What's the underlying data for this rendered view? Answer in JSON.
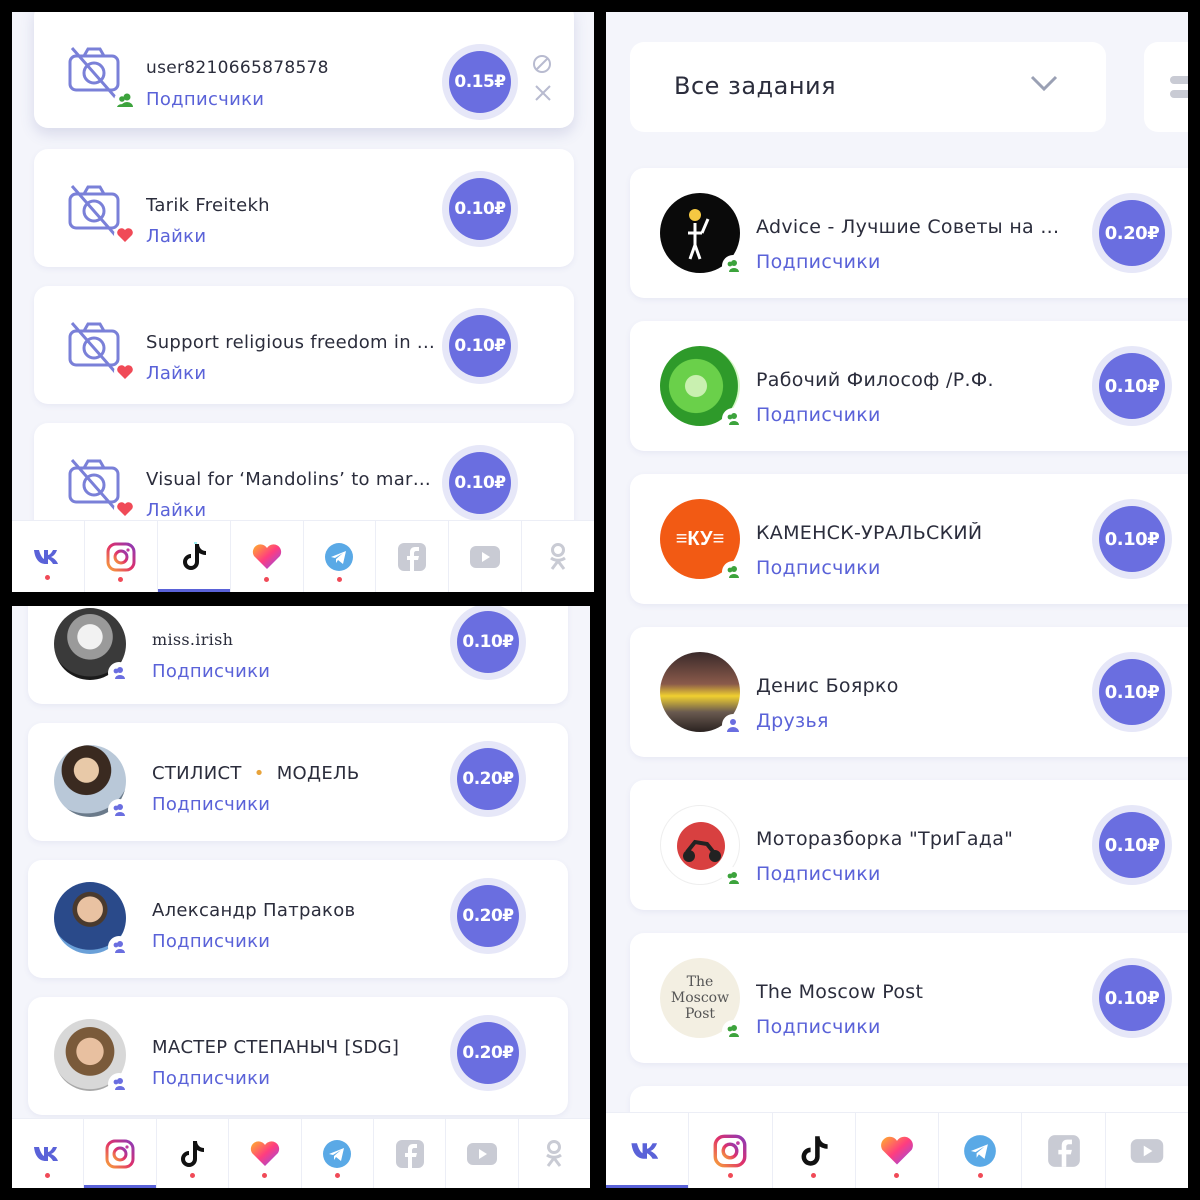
{
  "colors": {
    "accent": "#5a62d8",
    "price_fill": "#6a6ee0",
    "price_ring": "#e6e7f8",
    "heart": "#f04a57",
    "followers_badge": "#3ca33c",
    "friends_badge": "#6a6ee0",
    "panel_bg": "#f4f5fb"
  },
  "panel_a": {
    "tasks": [
      {
        "title": "user8210665878578",
        "type": "Подписчики",
        "price": "0.15₽",
        "avatar": "no-photo-icon",
        "badge": "followers-icon"
      },
      {
        "title": "Tarik Freitekh",
        "type": "Лайки",
        "price": "0.10₽",
        "avatar": "no-photo-icon",
        "badge": "heart-icon"
      },
      {
        "title": "Support religious freedom in ...",
        "type": "Лайки",
        "price": "0.10₽",
        "avatar": "no-photo-icon",
        "badge": "heart-icon"
      },
      {
        "title": "Visual for ‘Mandolins’ to mark...",
        "type": "Лайки",
        "price": "0.10₽",
        "avatar": "no-photo-icon",
        "badge": "heart-icon"
      }
    ],
    "active_tab": "tiktok"
  },
  "panel_b": {
    "tasks": [
      {
        "title": "miss.irish",
        "type": "Подписчики",
        "price": "0.10₽"
      },
      {
        "title": "СТИЛИСТ",
        "title_sep": "•",
        "title_2": "МОДЕЛЬ",
        "type": "Подписчики",
        "price": "0.20₽"
      },
      {
        "title": "Александр Патраков",
        "type": "Подписчики",
        "price": "0.20₽"
      },
      {
        "title": "МАСТЕР СТЕПАНЫЧ [SDG]",
        "type": "Подписчики",
        "price": "0.20₽"
      }
    ],
    "active_tab": "instagram"
  },
  "panel_c": {
    "filter_label": "Все задания",
    "tasks": [
      {
        "title": "Advice - Лучшие Советы на ...",
        "type": "Подписчики",
        "price": "0.20₽"
      },
      {
        "title": "Рабочий Философ /Р.Ф.",
        "type": "Подписчики",
        "price": "0.10₽"
      },
      {
        "title": "КАМЕНСК-УРАЛЬСКИЙ",
        "type": "Подписчики",
        "price": "0.10₽",
        "logo_text": "≡КУ≡"
      },
      {
        "title": "Денис Боярко",
        "type": "Друзья",
        "price": "0.10₽"
      },
      {
        "title": "Моторазборка \"ТриГада\"",
        "type": "Подписчики",
        "price": "0.10₽"
      },
      {
        "title": "The Moscow Post",
        "type": "Подписчики",
        "price": "0.10₽",
        "logo_text": "The Moscow Post"
      }
    ],
    "active_tab": "vk"
  },
  "tabs": [
    "vk",
    "instagram",
    "tiktok",
    "likee",
    "telegram",
    "facebook",
    "youtube",
    "odnoklassniki"
  ]
}
